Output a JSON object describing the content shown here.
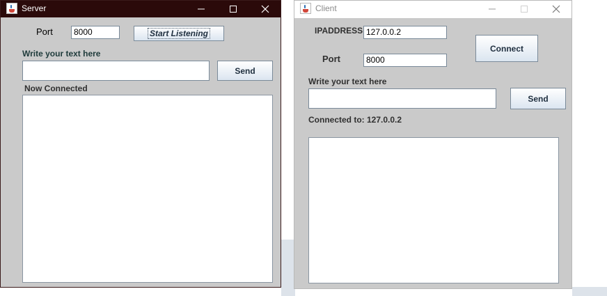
{
  "server": {
    "title": "Server",
    "port_label": "Port",
    "port_value": "8000",
    "start_button": "Start Listening",
    "write_label": "Write your text here",
    "message_value": "",
    "send_button": "Send",
    "status": "Now Connected",
    "log_text": ""
  },
  "client": {
    "title": "Client",
    "ip_label": "IPADDRESS",
    "ip_value": "127.0.0.2",
    "port_label": "Port",
    "port_value": "8000",
    "connect_button": "Connect",
    "write_label": "Write your text here",
    "message_value": "",
    "send_button": "Send",
    "status": "Connected to: 127.0.0.2",
    "log_text": ""
  },
  "colors": {
    "server_titlebar": "#2b0a0a",
    "client_titlebar": "#ffffff",
    "window_body": "#cacaca",
    "write_label_server": "#1f3b3b"
  }
}
